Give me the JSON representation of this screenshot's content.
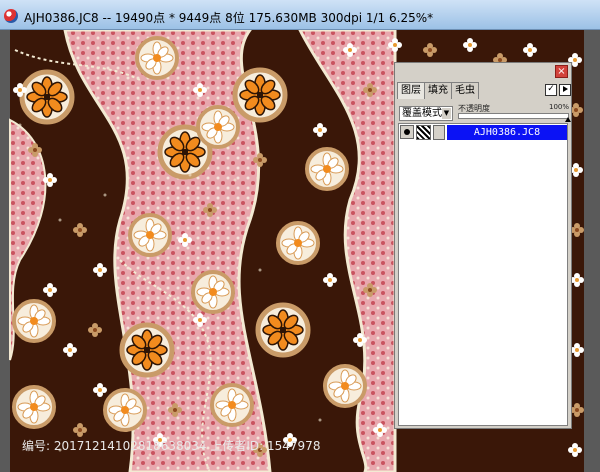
{
  "window": {
    "title": "AJH0386.JC8 -- 19490点 * 9449点 8位 175.630MB 300dpi 1/1  6.25%*"
  },
  "layers_panel": {
    "tabs": [
      {
        "label": "图层"
      },
      {
        "label": "填充"
      },
      {
        "label": "毛虫"
      }
    ],
    "close_glyph": "×",
    "check_glyph": "✓",
    "blend_mode": "覆盖模式",
    "dropdown_glyph": "▼",
    "opacity_label": "不透明度",
    "opacity_value": "100%",
    "opacity": 1.0,
    "layers": [
      {
        "name": "AJH0386.JC8"
      }
    ]
  },
  "watermark": "编号: 20171214102818638034 上传者ID: 1547978",
  "colors": {
    "background": "#3a1708",
    "cream": "#f3ead3",
    "orange": "#f28b1e",
    "pink": "#e07f8a",
    "tan": "#c99b68",
    "layer_highlight": "#0b12f5",
    "titlebar": "#b9d4f0"
  },
  "icons": {
    "app": "app-icon",
    "close": "close-icon",
    "check": "check-icon",
    "menu": "panel-menu-arrow-icon",
    "visibility": "eye-icon",
    "thumbnail": "layer-thumbnail-icon"
  }
}
